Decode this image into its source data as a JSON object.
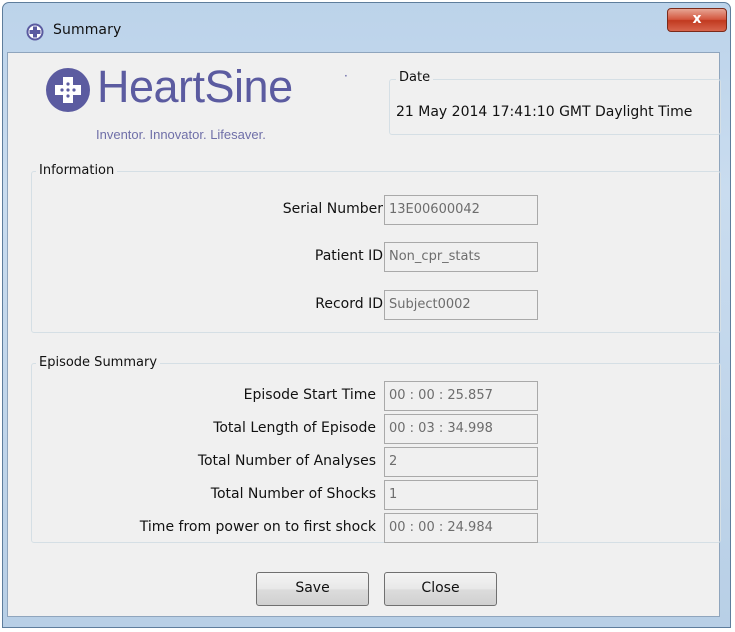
{
  "window": {
    "title": "Summary",
    "close_glyph": "x",
    "icon": "heartsine-app-icon"
  },
  "logo": {
    "brand": "HeartSine",
    "registered": "·",
    "tagline": "Inventor. Innovator. Lifesaver.",
    "brand_color": "#5b5ba0"
  },
  "date": {
    "label": "Date",
    "value": "21 May 2014 17:41:10 GMT Daylight Time"
  },
  "information": {
    "label": "Information",
    "rows": [
      {
        "label": "Serial Number",
        "value": "13E00600042"
      },
      {
        "label": "Patient ID",
        "value": "Non_cpr_stats"
      },
      {
        "label": "Record ID",
        "value": "Subject0002"
      }
    ]
  },
  "episode": {
    "label": "Episode Summary",
    "rows": [
      {
        "label": "Episode Start Time",
        "value": "00 : 00 : 25.857"
      },
      {
        "label": "Total Length of Episode",
        "value": "00 : 03 : 34.998"
      },
      {
        "label": "Total Number of Analyses",
        "value": "2"
      },
      {
        "label": "Total Number of Shocks",
        "value": "1"
      },
      {
        "label": "Time from power on to first shock",
        "value": "00 : 00 : 24.984"
      }
    ]
  },
  "buttons": {
    "save": "Save",
    "close": "Close"
  }
}
